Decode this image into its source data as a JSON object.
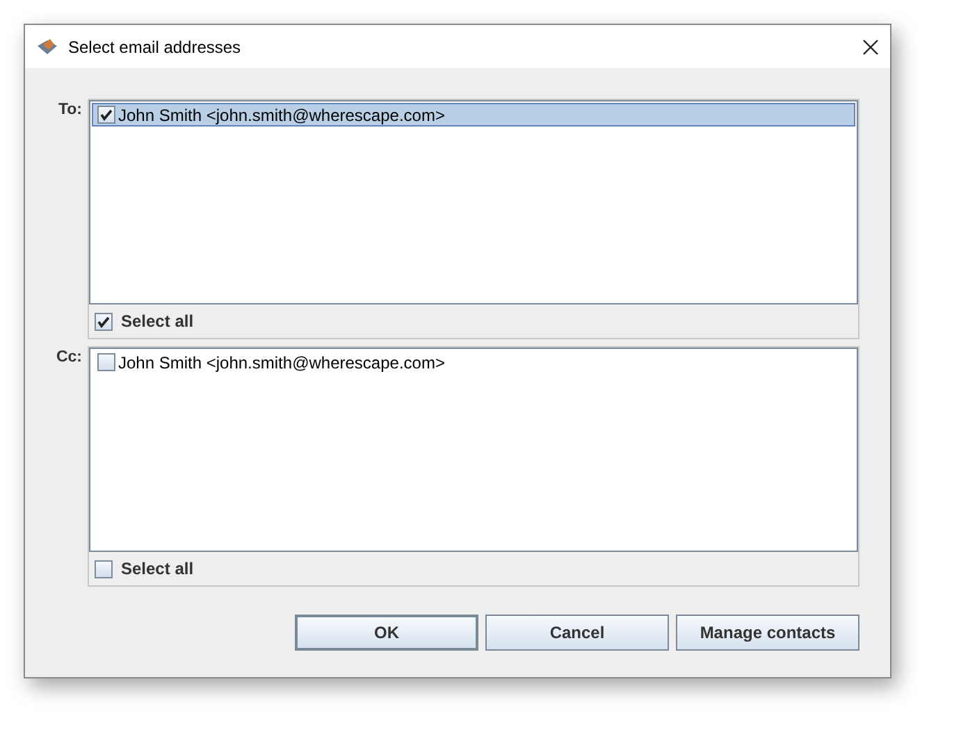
{
  "window": {
    "title": "Select email addresses"
  },
  "sections": [
    {
      "label": "To:",
      "recipients": [
        {
          "text": "John Smith <john.smith@wherescape.com>",
          "checked": true,
          "selected": true
        }
      ],
      "select_all": {
        "label": "Select all",
        "checked": true
      }
    },
    {
      "label": "Cc:",
      "recipients": [
        {
          "text": "John Smith <john.smith@wherescape.com>",
          "checked": false,
          "selected": false
        }
      ],
      "select_all": {
        "label": "Select all",
        "checked": false
      }
    }
  ],
  "buttons": [
    {
      "label": "OK",
      "default": true
    },
    {
      "label": "Cancel",
      "default": false
    },
    {
      "label": "Manage contacts",
      "default": false
    }
  ]
}
